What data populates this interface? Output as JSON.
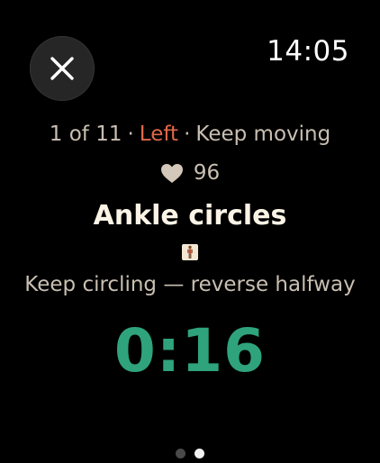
{
  "status_bar": {
    "time": "14:05"
  },
  "controls": {
    "close_icon": "close-icon"
  },
  "exercise": {
    "position": "1 of 11",
    "side": "Left",
    "separator": "·",
    "status": "Keep moving",
    "heart_rate": "96",
    "name": "Ankle circles",
    "figure_icon": "standing-figure-icon",
    "instruction": "Keep circling — reverse halfway",
    "timer": "0:16"
  },
  "pager": {
    "pages": 2,
    "current": 2
  },
  "colors": {
    "background": "#000000",
    "side_accent": "#e0684b",
    "timer": "#2fa37c",
    "muted_text": "#c9bfb2",
    "title_text": "#fbf4e6",
    "close_button_bg": "#262626"
  }
}
